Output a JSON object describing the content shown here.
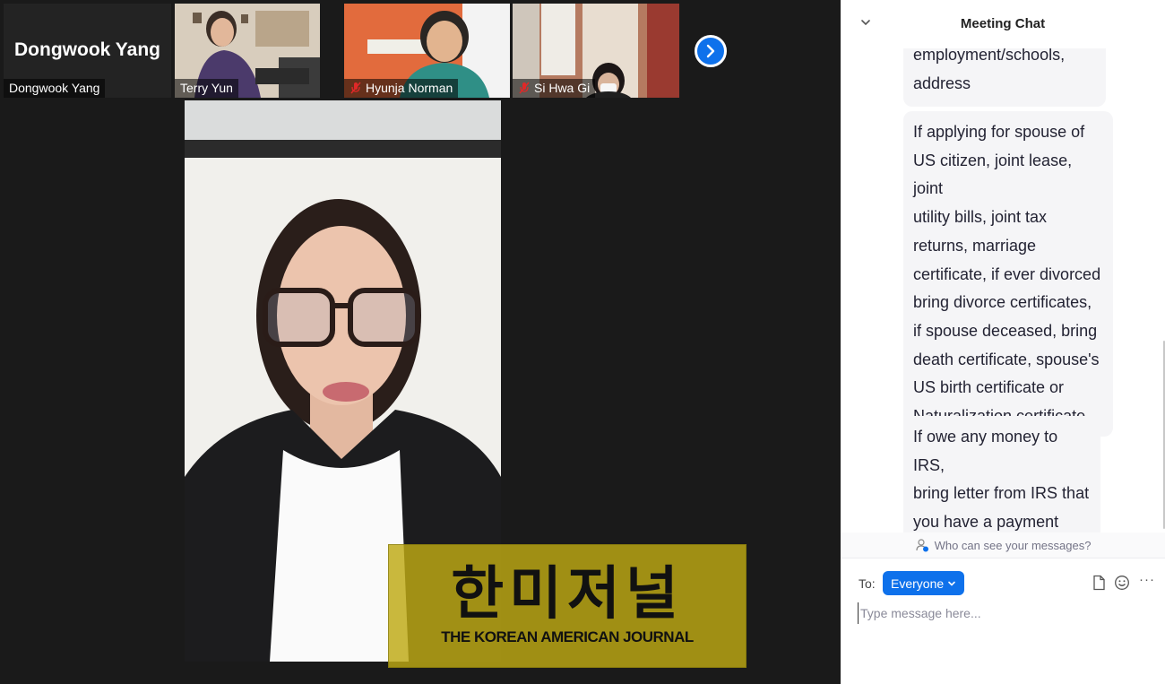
{
  "participants": [
    {
      "name": "Dongwook Yang",
      "display_name": "Dongwook Yang",
      "muted": false
    },
    {
      "name": "Terry Yun",
      "muted": false
    },
    {
      "name": "Hyunja Norman",
      "muted": true
    },
    {
      "name": "Si Hwa Gi",
      "muted": true
    }
  ],
  "watermark": {
    "korean": "한미저널",
    "english": "THE KOREAN AMERICAN JOURNAL"
  },
  "chat": {
    "title": "Meeting Chat",
    "messages": [
      {
        "text": "employment/schools,\naddress"
      },
      {
        "text": "If applying for spouse of\nUS citizen, joint lease, joint\nutility bills, joint tax\nreturns, marriage\ncertificate, if ever divorced\nbring divorce certificates,\nif spouse deceased, bring\ndeath certificate, spouse's\nUS birth certificate or\nNaturalization certificate"
      },
      {
        "text": "If owe any money to IRS,\nbring letter from IRS that\nyou have a payment plan"
      }
    ],
    "visibility_note": "Who can see your messages?",
    "compose": {
      "to_label": "To:",
      "recipient": "Everyone",
      "placeholder": "Type message here...",
      "more": "···"
    }
  },
  "colors": {
    "accent": "#0e71eb",
    "panel_bg": "#ffffff",
    "video_bg": "#1a1a1a",
    "bubble_bg": "#f5f5f7",
    "watermark": "#bfaa14"
  }
}
